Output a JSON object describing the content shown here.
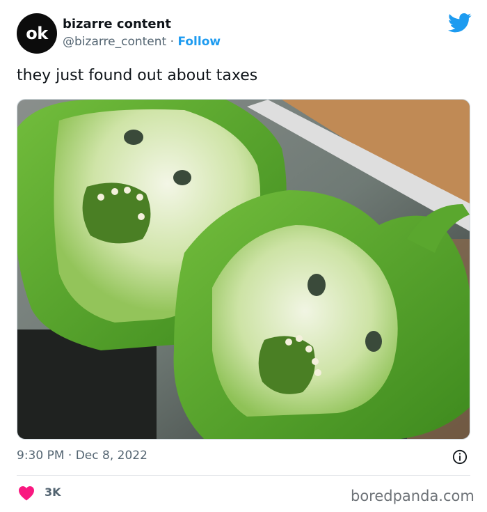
{
  "author": {
    "avatar_text": "ok",
    "display_name": "bizarre content",
    "handle": "@bizarre_content",
    "separator": "·",
    "follow_label": "Follow"
  },
  "tweet": {
    "text": "they just found out about taxes",
    "image_subject": "two halved green bell peppers that look like screaming faces",
    "time": "9:30 PM",
    "date_separator": "·",
    "date": "Dec 8, 2022"
  },
  "engagement": {
    "likes": "3K"
  },
  "watermark": "boredpanda.com",
  "icons": {
    "platform": "twitter-bird-icon",
    "info": "info-icon",
    "like": "heart-icon"
  },
  "colors": {
    "accent": "#1d9bf0",
    "heart": "#f91880",
    "secondary_text": "#536471",
    "pepper_green": "#4f9a2a"
  }
}
